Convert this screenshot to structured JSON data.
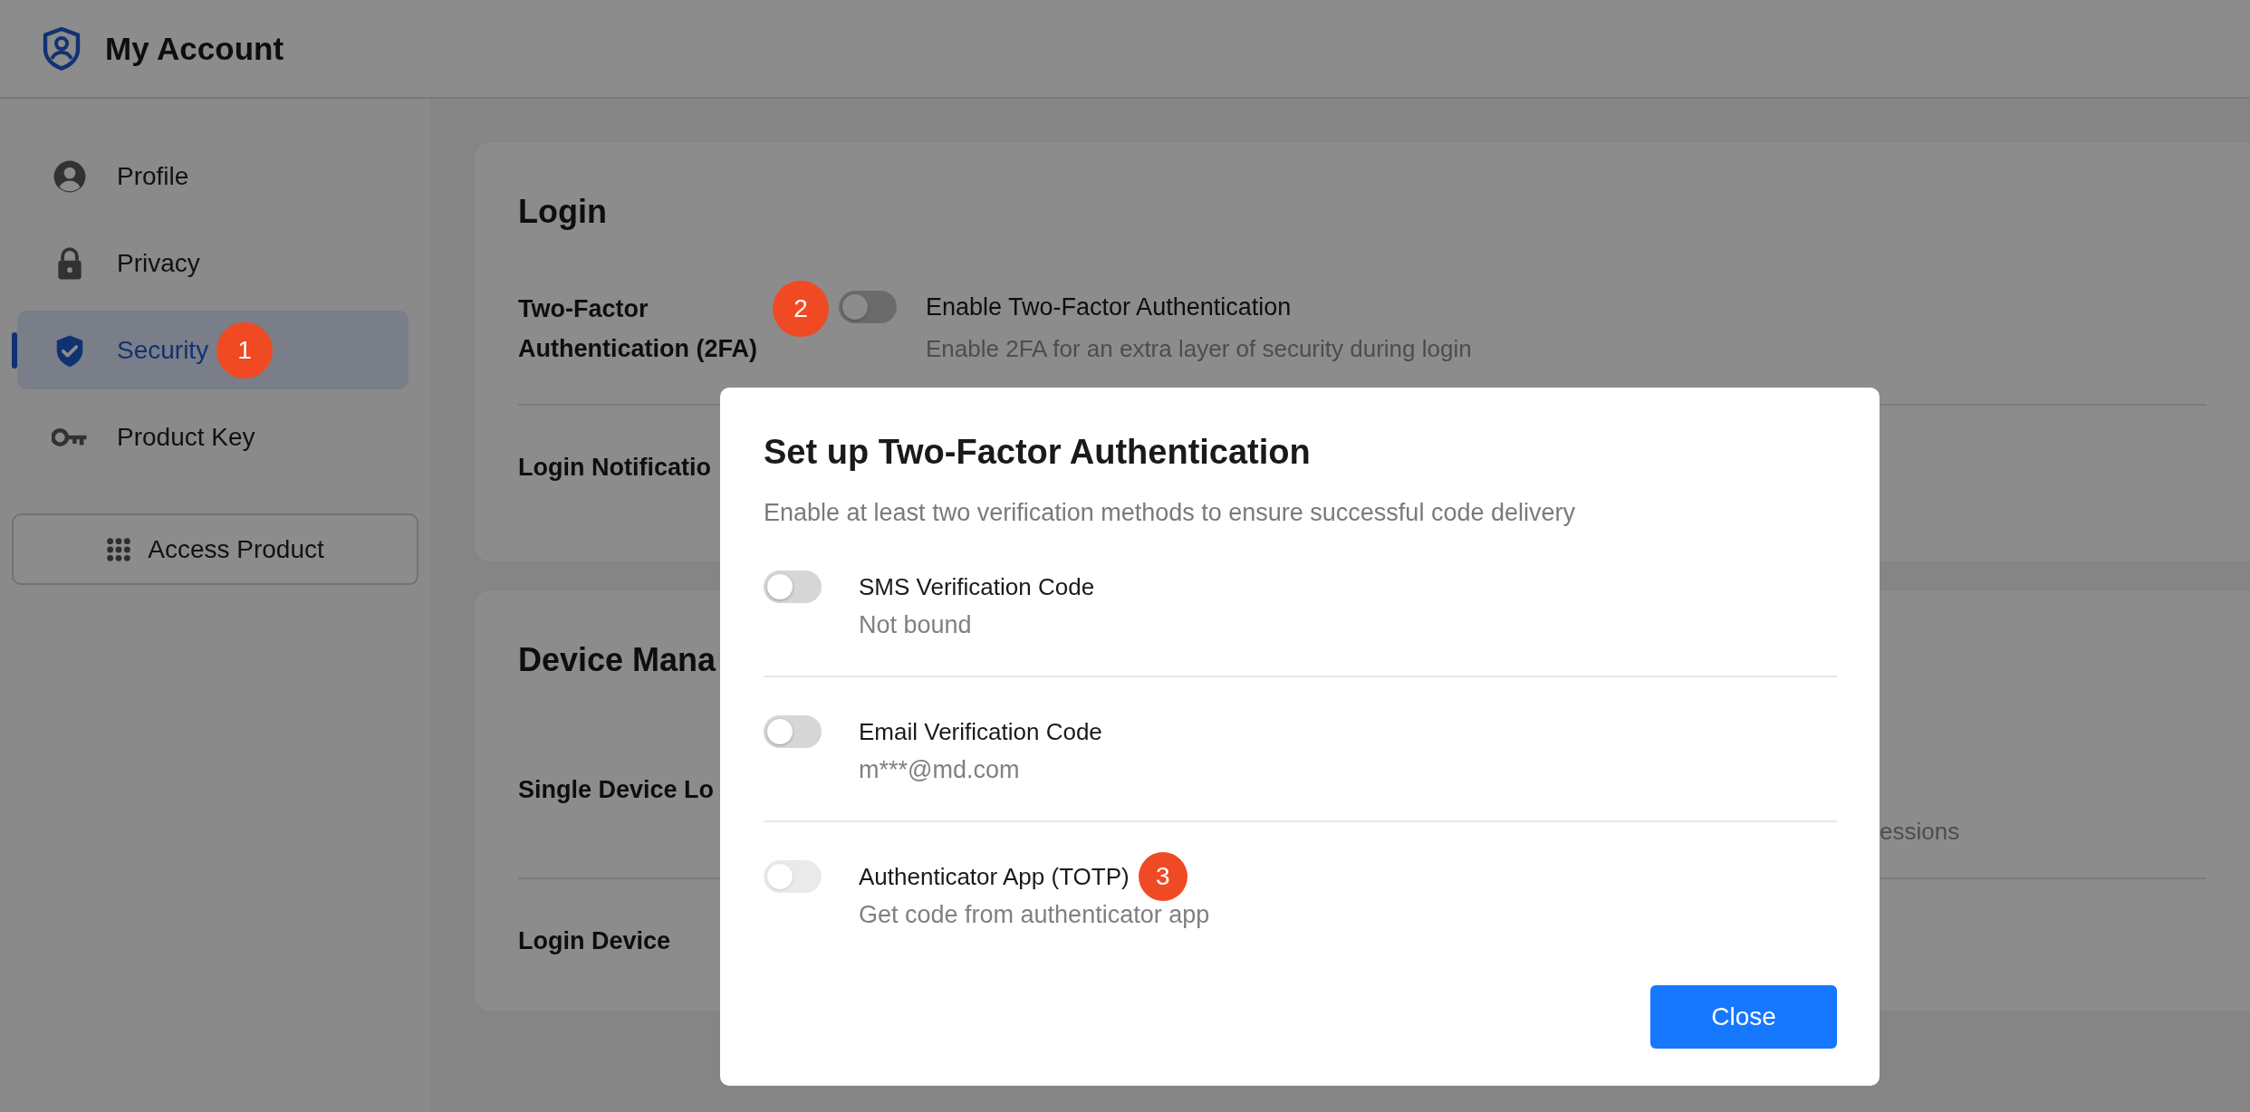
{
  "header": {
    "title": "My Account"
  },
  "sidebar": {
    "items": [
      {
        "kind": "profile",
        "label": "Profile",
        "selected": false
      },
      {
        "kind": "lock",
        "label": "Privacy",
        "selected": false
      },
      {
        "kind": "shield",
        "label": "Security",
        "selected": true,
        "badge": "1"
      },
      {
        "kind": "key",
        "label": "Product Key",
        "selected": false
      }
    ],
    "button": "Access Product"
  },
  "sections": [
    {
      "title": "Login",
      "rows": [
        {
          "label": "Two-Factor Authentication (2FA)",
          "badge": "2",
          "on": false,
          "title": "Enable Two-Factor Authentication",
          "description": "Enable 2FA for an extra layer of security during login"
        },
        {
          "label": "Login Notificatio"
        }
      ]
    },
    {
      "title": "Device Mana",
      "rows": [
        {
          "label": "Single Device Lo",
          "description": "essions"
        },
        {
          "label": "Login Device"
        }
      ]
    }
  ],
  "dialog": {
    "title": "Set up Two-Factor Authentication",
    "subtitle": "Enable at least two verification methods to ensure successful code delivery",
    "methods": [
      {
        "title": "SMS Verification Code",
        "detail": "Not bound",
        "on": false,
        "disabled": false
      },
      {
        "title": "Email Verification Code",
        "detail": "m***@md.com",
        "on": false,
        "disabled": false
      },
      {
        "title": "Authenticator App (TOTP)",
        "detail": "Get code from authenticator app",
        "on": false,
        "disabled": true,
        "badge": "3"
      }
    ],
    "button": "Close"
  }
}
